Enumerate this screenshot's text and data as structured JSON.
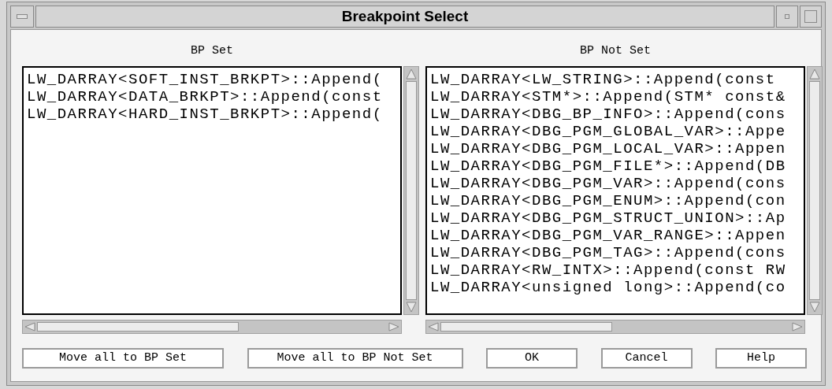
{
  "window": {
    "title": "Breakpoint Select"
  },
  "lists": [
    {
      "label": "BP Set",
      "items": [
        "LW_DARRAY<SOFT_INST_BRKPT>::Append(",
        "LW_DARRAY<DATA_BRKPT>::Append(const",
        "LW_DARRAY<HARD_INST_BRKPT>::Append("
      ]
    },
    {
      "label": "BP Not Set",
      "items": [
        "LW_DARRAY<LW_STRING>::Append(const",
        "LW_DARRAY<STM*>::Append(STM* const&",
        "LW_DARRAY<DBG_BP_INFO>::Append(cons",
        "LW_DARRAY<DBG_PGM_GLOBAL_VAR>::Appe",
        "LW_DARRAY<DBG_PGM_LOCAL_VAR>::Appen",
        "LW_DARRAY<DBG_PGM_FILE*>::Append(DB",
        "LW_DARRAY<DBG_PGM_VAR>::Append(cons",
        "LW_DARRAY<DBG_PGM_ENUM>::Append(con",
        "LW_DARRAY<DBG_PGM_STRUCT_UNION>::Ap",
        "LW_DARRAY<DBG_PGM_VAR_RANGE>::Appen",
        "LW_DARRAY<DBG_PGM_TAG>::Append(cons",
        "LW_DARRAY<RW_INTX>::Append(const RW",
        "LW_DARRAY<unsigned long>::Append(co"
      ]
    }
  ],
  "buttons": [
    "Move all to BP Set",
    "Move all to BP Not Set",
    "OK",
    "Cancel",
    "Help"
  ]
}
